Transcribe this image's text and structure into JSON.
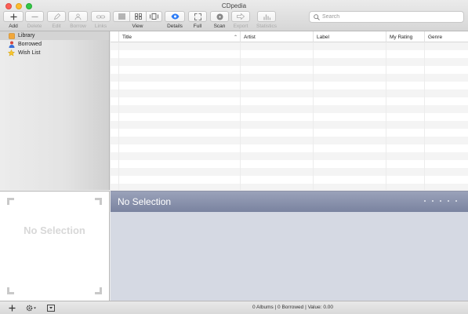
{
  "window": {
    "title": "CDpedia"
  },
  "toolbar": {
    "add": "Add",
    "delete": "Delete",
    "edit": "Edit",
    "borrow": "Borrow",
    "links": "Links",
    "view": "View",
    "details": "Details",
    "full": "Full",
    "scan": "Scan",
    "export": "Export",
    "statistics": "Statistics"
  },
  "search": {
    "placeholder": "Search",
    "value": ""
  },
  "sidebar": {
    "items": [
      {
        "label": "Library",
        "icon": "library-icon",
        "selected": true
      },
      {
        "label": "Borrowed",
        "icon": "person-icon",
        "selected": false
      },
      {
        "label": "Wish List",
        "icon": "star-icon",
        "selected": false
      }
    ]
  },
  "table": {
    "columns": [
      "Title",
      "Artist",
      "Label",
      "My Rating",
      "Genre"
    ],
    "sort_column": "Title",
    "sort_direction": "ascending",
    "rows": []
  },
  "artwork": {
    "placeholder": "No Selection"
  },
  "detail": {
    "title": "No Selection"
  },
  "status": {
    "text": "0 Albums | 0 Borrowed | Value: 0.00"
  },
  "colors": {
    "detail_header": "#8a92ad",
    "detail_body": "#d5d9e3",
    "details_accent": "#2d7cf6"
  }
}
